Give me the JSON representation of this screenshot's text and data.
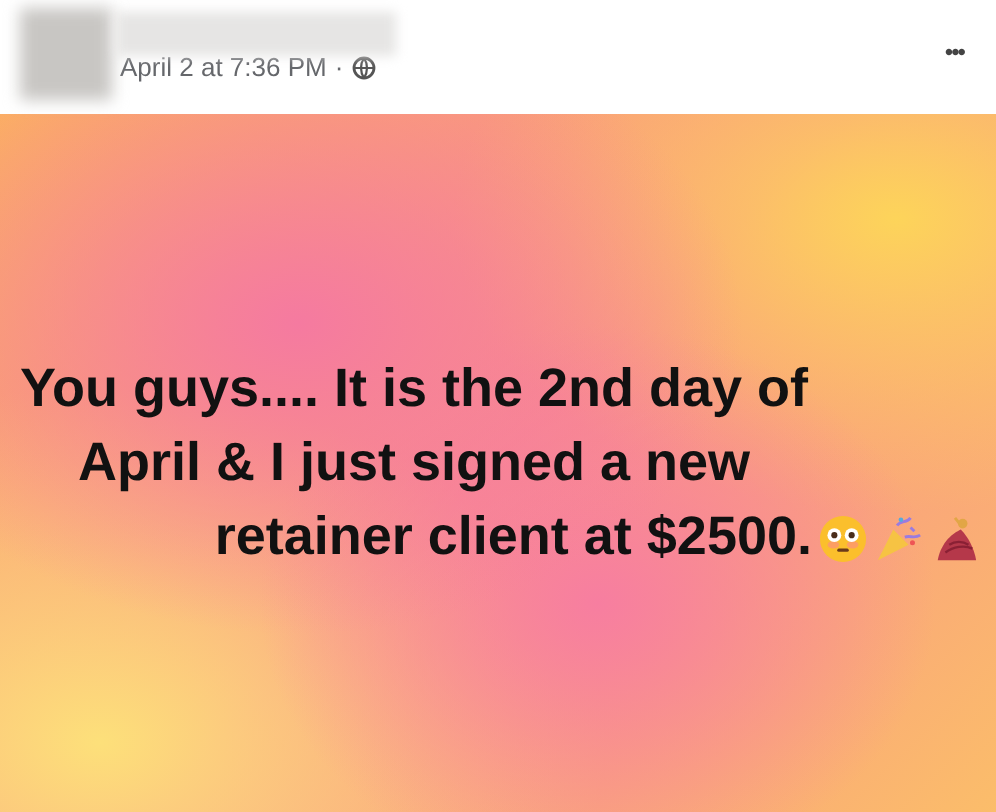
{
  "post": {
    "timestamp": "April 2 at 7:36 PM",
    "separator": "·",
    "menu": "•••"
  },
  "body": {
    "text": "You guys.... It is the 2nd day of April & I just signed a new retainer client at $2500."
  }
}
